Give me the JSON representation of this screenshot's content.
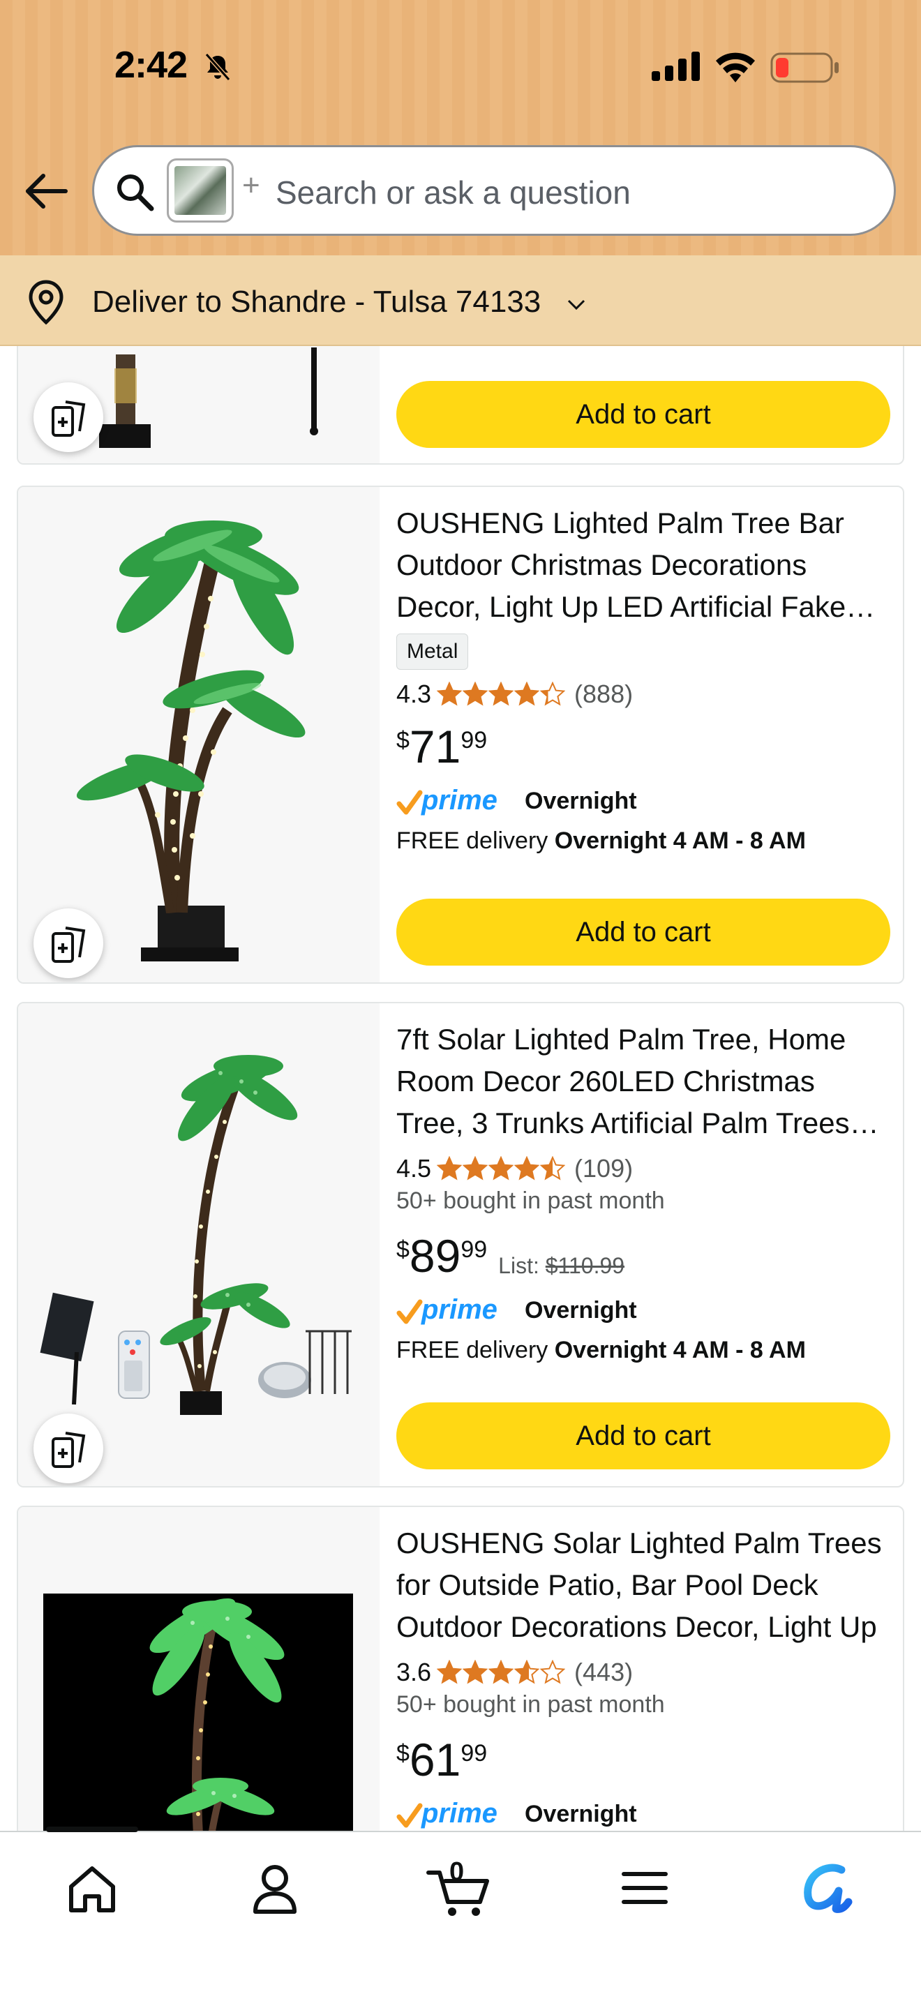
{
  "status_bar": {
    "time": "2:42",
    "icons": [
      "bell-slash-icon",
      "signal-icon",
      "wifi-icon",
      "battery-low-icon"
    ]
  },
  "search": {
    "placeholder": "Search or ask a question",
    "plus": "+"
  },
  "delivery": {
    "text": "Deliver to Shandre - Tulsa 74133"
  },
  "colors": {
    "header": "#e9b378",
    "deliver_bar": "#f1d6a9",
    "cart_button": "#ffd814",
    "star": "#de7921",
    "prime_blue": "#1a98ff",
    "prime_check": "#f79c1e"
  },
  "products": [
    {
      "add_to_cart": "Add to cart"
    },
    {
      "title": "OUSHENG Lighted Palm Tree Bar Outdoor Christmas Decorations Decor, Light Up LED Artificial Fake Palm Tree",
      "badge": "Metal",
      "rating": "4.3",
      "stars": 4.3,
      "reviews": "(888)",
      "price_symbol": "$",
      "price_whole": "71",
      "price_fraction": "99",
      "prime_label": "Overnight",
      "delivery_prefix": "FREE delivery ",
      "delivery_window": "Overnight 4 AM - 8 AM",
      "add_to_cart": "Add to cart"
    },
    {
      "title": "7ft Solar Lighted Palm Tree, Home Room Decor 260LED Christmas Tree, 3 Trunks Artificial Palm Trees for Outdoor",
      "rating": "4.5",
      "stars": 4.5,
      "reviews": "(109)",
      "bought": "50+ bought in past month",
      "price_symbol": "$",
      "price_whole": "89",
      "price_fraction": "99",
      "list_label": "List: ",
      "list_price": "$110.99",
      "prime_label": "Overnight",
      "delivery_prefix": "FREE delivery ",
      "delivery_window": "Overnight 4 AM - 8 AM",
      "add_to_cart": "Add to cart"
    },
    {
      "title": "OUSHENG Solar Lighted Palm Trees for Outside Patio, Bar Pool Deck Outdoor Decorations Decor, Light Up",
      "rating": "3.6",
      "stars": 3.6,
      "reviews": "(443)",
      "bought": "50+ bought in past month",
      "price_symbol": "$",
      "price_whole": "61",
      "price_fraction": "99",
      "prime_label": "Overnight"
    }
  ],
  "bottom_nav": {
    "items": [
      "home-icon",
      "account-icon",
      "cart-icon",
      "menu-icon",
      "rufus-icon"
    ],
    "cart_count": "0"
  }
}
